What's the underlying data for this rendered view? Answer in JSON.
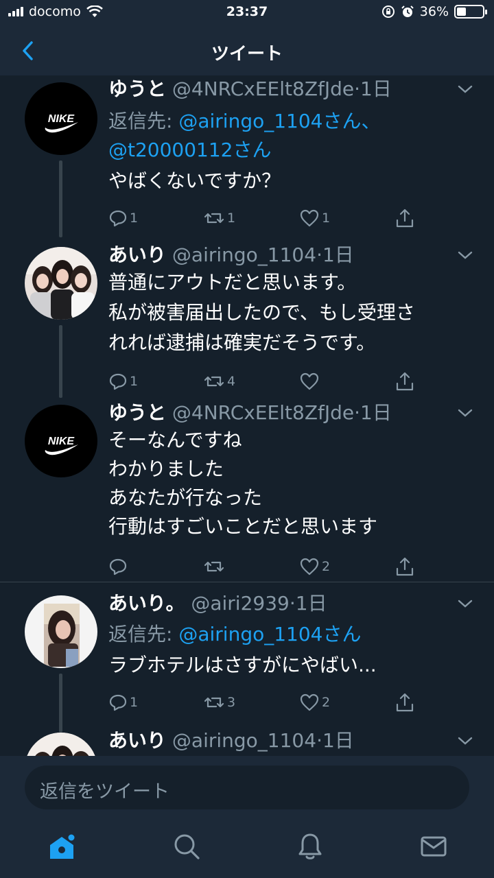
{
  "status_bar": {
    "carrier": "docomo",
    "time": "23:37",
    "battery": "36%",
    "battery_level": 0.36
  },
  "nav": {
    "title": "ツイート"
  },
  "tweets": [
    {
      "name": "ゆうと",
      "handle": "@4NRCxEElt8ZfJde",
      "time": "1日",
      "reply_prefix": "返信先: ",
      "reply_mention_1": "@airingo_1104さん、",
      "reply_mention_2": "@t20000112さん",
      "lines": [
        "やばくないですか？"
      ],
      "reply_count": "1",
      "retweet_count": "1",
      "like_count": "1",
      "avatar_logo_text": "NIKE"
    },
    {
      "name": "あいり",
      "handle": "@airingo_1104",
      "time": "1日",
      "lines": [
        "普通にアウトだと思います。",
        "私が被害届出したので、もし受理さ",
        "れれば逮捕は確実だそうです。"
      ],
      "reply_count": "1",
      "retweet_count": "4",
      "like_count": ""
    },
    {
      "name": "ゆうと",
      "handle": "@4NRCxEElt8ZfJde",
      "time": "1日",
      "lines": [
        "そーなんですね",
        "わかりました",
        "あなたが行なった",
        "行動はすごいことだと思います"
      ],
      "reply_count": "",
      "retweet_count": "",
      "like_count": "2",
      "avatar_logo_text": "NIKE"
    },
    {
      "name": "あいり。",
      "handle": "@airi2939",
      "time": "1日",
      "reply_prefix": "返信先: ",
      "reply_mention_1": "@airingo_1104さん",
      "lines": [
        "ラブホテルはさすがにやばい..."
      ],
      "reply_count": "1",
      "retweet_count": "3",
      "like_count": "2"
    },
    {
      "name": "あいり",
      "handle": "@airingo_1104",
      "time": "1日"
    }
  ],
  "reply_bar": {
    "placeholder": "返信をツイート"
  },
  "tab_bar": {
    "tabs": [
      "home-icon",
      "search-icon",
      "notifications-icon",
      "messages-icon"
    ]
  },
  "colors": {
    "background": "#15202b",
    "bar": "#1c2938",
    "accent": "#1da1f2",
    "muted": "#8899a6",
    "divider": "#38444d"
  }
}
